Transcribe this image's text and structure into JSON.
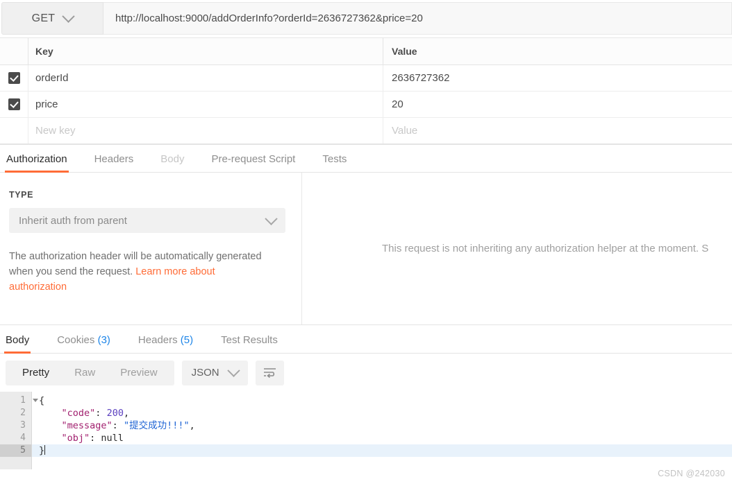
{
  "request": {
    "method": "GET",
    "url": "http://localhost:9000/addOrderInfo?orderId=2636727362&price=20"
  },
  "params_table": {
    "headers": {
      "key": "Key",
      "value": "Value"
    },
    "rows": [
      {
        "checked": true,
        "key": "orderId",
        "value": "2636727362"
      },
      {
        "checked": true,
        "key": "price",
        "value": "20"
      }
    ],
    "new_row": {
      "key_placeholder": "New key",
      "value_placeholder": "Value"
    }
  },
  "request_tabs": [
    {
      "label": "Authorization",
      "state": "active"
    },
    {
      "label": "Headers",
      "state": "normal"
    },
    {
      "label": "Body",
      "state": "disabled"
    },
    {
      "label": "Pre-request Script",
      "state": "normal"
    },
    {
      "label": "Tests",
      "state": "normal"
    }
  ],
  "authorization": {
    "type_label": "TYPE",
    "type_value": "Inherit auth from parent",
    "description_text": "The authorization header will be automatically generated when you send the request. ",
    "description_link": "Learn more about authorization",
    "right_message": "This request is not inheriting any authorization helper at the moment. S"
  },
  "response_tabs": [
    {
      "label": "Body",
      "count": "",
      "state": "active"
    },
    {
      "label": "Cookies",
      "count": "(3)",
      "state": "normal"
    },
    {
      "label": "Headers",
      "count": "(5)",
      "state": "normal"
    },
    {
      "label": "Test Results",
      "count": "",
      "state": "normal"
    }
  ],
  "body_toolbar": {
    "views": [
      {
        "label": "Pretty",
        "state": "active"
      },
      {
        "label": "Raw",
        "state": "normal"
      },
      {
        "label": "Preview",
        "state": "normal"
      }
    ],
    "format": "JSON",
    "wrap_icon": "word-wrap-icon"
  },
  "response_body": {
    "lines": [
      {
        "num": "1",
        "fold": true,
        "current": false,
        "segments": [
          {
            "t": "{",
            "c": "k-punct"
          }
        ]
      },
      {
        "num": "2",
        "fold": false,
        "current": false,
        "segments": [
          {
            "t": "    ",
            "c": "k-punct"
          },
          {
            "t": "\"code\"",
            "c": "k-key"
          },
          {
            "t": ": ",
            "c": "k-punct"
          },
          {
            "t": "200",
            "c": "k-num"
          },
          {
            "t": ",",
            "c": "k-punct"
          }
        ]
      },
      {
        "num": "3",
        "fold": false,
        "current": false,
        "segments": [
          {
            "t": "    ",
            "c": "k-punct"
          },
          {
            "t": "\"message\"",
            "c": "k-key"
          },
          {
            "t": ": ",
            "c": "k-punct"
          },
          {
            "t": "\"提交成功!!!\"",
            "c": "k-str"
          },
          {
            "t": ",",
            "c": "k-punct"
          }
        ]
      },
      {
        "num": "4",
        "fold": false,
        "current": false,
        "segments": [
          {
            "t": "    ",
            "c": "k-punct"
          },
          {
            "t": "\"obj\"",
            "c": "k-key"
          },
          {
            "t": ": ",
            "c": "k-punct"
          },
          {
            "t": "null",
            "c": "k-null"
          }
        ]
      },
      {
        "num": "5",
        "fold": false,
        "current": true,
        "segments": [
          {
            "t": "}",
            "c": "k-punct"
          }
        ]
      }
    ]
  },
  "watermark": "CSDN @242030",
  "colors": {
    "accent": "#ff6c37",
    "count_blue": "#1d85e8",
    "json_key": "#a11f6e",
    "json_string": "#1d63d4",
    "json_number": "#5a3fbf"
  }
}
